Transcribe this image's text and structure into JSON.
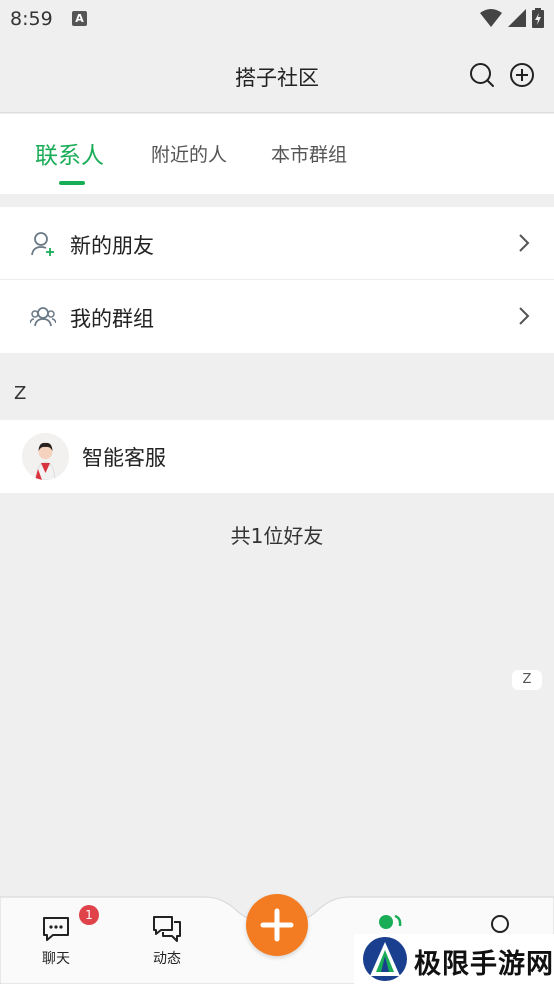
{
  "status_bar": {
    "time": "8:59",
    "notification_icon": "a-letter-icon"
  },
  "header": {
    "title": "搭子社区",
    "search_icon": "search-icon",
    "add_icon": "plus-circle-icon"
  },
  "tabs": [
    {
      "label": "联系人",
      "active": true
    },
    {
      "label": "附近的人",
      "active": false
    },
    {
      "label": "本市群组",
      "active": false
    }
  ],
  "menu": [
    {
      "label": "新的朋友",
      "icon": "add-person-icon"
    },
    {
      "label": "我的群组",
      "icon": "group-icon"
    }
  ],
  "section_letter": "Z",
  "contacts": [
    {
      "name": "智能客服"
    }
  ],
  "friend_count": "共1位好友",
  "index_letter": "Z",
  "bottom_nav": {
    "items": [
      {
        "label": "聊天",
        "badge": "1"
      },
      {
        "label": "动态"
      }
    ],
    "accent": "#f37c22"
  },
  "watermark": {
    "text": "极限手游网"
  },
  "colors": {
    "active_green": "#1aad57",
    "badge_red": "#e0424a"
  }
}
